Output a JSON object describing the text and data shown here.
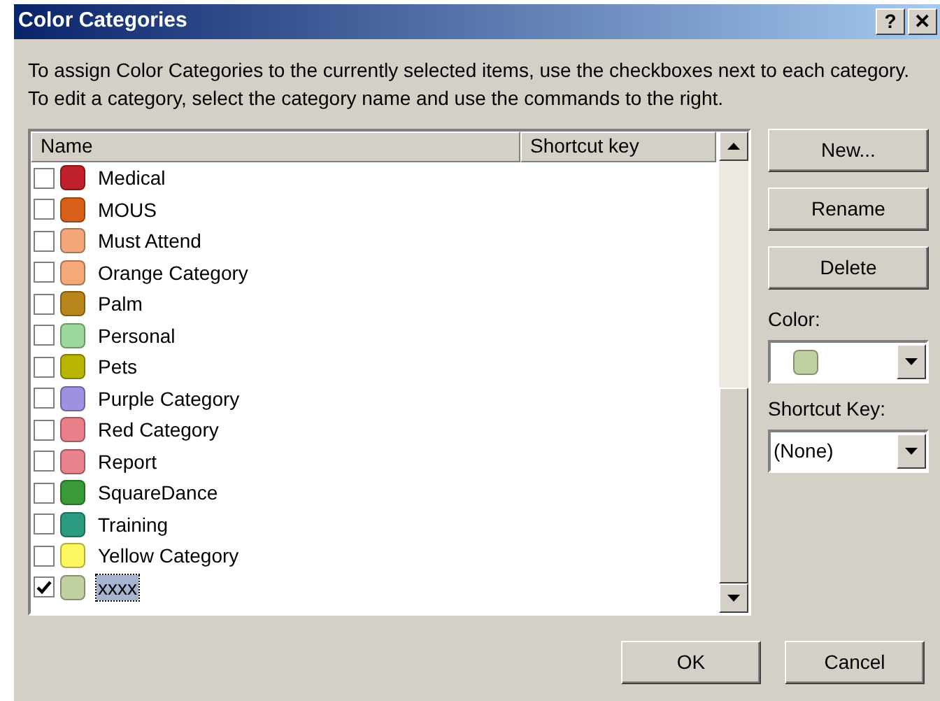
{
  "window": {
    "title": "Color Categories",
    "help_button": "?",
    "close_button": "✕"
  },
  "instructions": "To assign Color Categories to the currently selected items, use the checkboxes next to each category.  To edit a category, select the category name and use the commands to the right.",
  "table": {
    "columns": [
      "Name",
      "Shortcut key"
    ],
    "rows": [
      {
        "name": "Medical",
        "color": "#c0202c",
        "checked": false,
        "selected": false
      },
      {
        "name": "MOUS",
        "color": "#d8601a",
        "checked": false,
        "selected": false
      },
      {
        "name": "Must Attend",
        "color": "#f4a77a",
        "checked": false,
        "selected": false
      },
      {
        "name": "Orange Category",
        "color": "#f5a878",
        "checked": false,
        "selected": false
      },
      {
        "name": "Palm",
        "color": "#b8861c",
        "checked": false,
        "selected": false
      },
      {
        "name": "Personal",
        "color": "#9cd89c",
        "checked": false,
        "selected": false
      },
      {
        "name": "Pets",
        "color": "#b8b400",
        "checked": false,
        "selected": false
      },
      {
        "name": "Purple Category",
        "color": "#a090e0",
        "checked": false,
        "selected": false
      },
      {
        "name": "Red Category",
        "color": "#e8808a",
        "checked": false,
        "selected": false
      },
      {
        "name": "Report",
        "color": "#e8828c",
        "checked": false,
        "selected": false
      },
      {
        "name": "SquareDance",
        "color": "#3a9a3a",
        "checked": false,
        "selected": false
      },
      {
        "name": "Training",
        "color": "#2a9a80",
        "checked": false,
        "selected": false
      },
      {
        "name": "Yellow Category",
        "color": "#fef860",
        "checked": false,
        "selected": false
      },
      {
        "name": "xxxx",
        "color": "#c0d0a0",
        "checked": true,
        "selected": true
      }
    ]
  },
  "buttons": [
    "New...",
    "Rename",
    "Delete"
  ],
  "color_field": {
    "label": "Color:",
    "color": "#c0d0a0"
  },
  "shortcut_field": {
    "label": "Shortcut Key:",
    "value": "(None)"
  },
  "footer_buttons": [
    "OK",
    "Cancel"
  ]
}
